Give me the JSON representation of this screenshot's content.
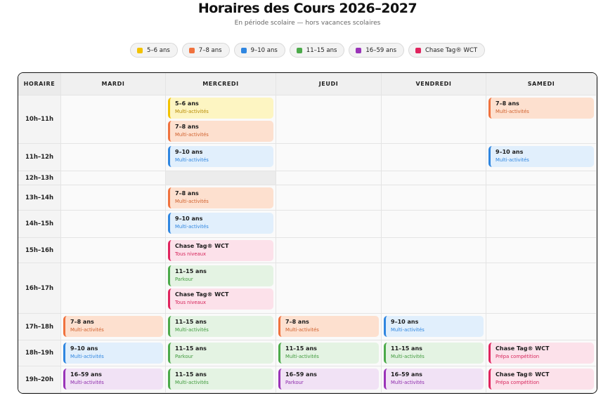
{
  "title": "Horaires des Cours 2026–2027",
  "subtitle": "En période scolaire — hors vacances scolaires",
  "groups": {
    "g56": {
      "label": "5–6 ans",
      "color": "#f2c200",
      "cls": "g-y"
    },
    "g78": {
      "label": "7–8 ans",
      "color": "#f0723e",
      "cls": "g-o"
    },
    "g910": {
      "label": "9–10 ans",
      "color": "#2f86e0",
      "cls": "g-b"
    },
    "g1115": {
      "label": "11–15 ans",
      "color": "#4caa4a",
      "cls": "g-g"
    },
    "g1659": {
      "label": "16–59 ans",
      "color": "#9a33b8",
      "cls": "g-p"
    },
    "gct": {
      "label": "Chase Tag® WCT",
      "color": "#e0245e",
      "cls": "g-r"
    }
  },
  "legend": [
    "g56",
    "g78",
    "g910",
    "g1115",
    "g1659",
    "gct"
  ],
  "header": {
    "horaire": "HORAIRE",
    "days": [
      "MARDI",
      "MERCREDI",
      "JEUDI",
      "VENDREDI",
      "SAMEDI"
    ]
  },
  "slots": [
    "10h–11h",
    "11h–12h",
    "12h–13h",
    "13h–14h",
    "14h–15h",
    "15h–16h",
    "16h–17h",
    "17h–18h",
    "18h–19h",
    "19h–20h"
  ],
  "lunch_slot": "12h–13h",
  "classes": [
    {
      "day": "MERCREDI",
      "slot": "10h–11h",
      "items": [
        {
          "group": "g56",
          "label": "5–6 ans",
          "activity": "Multi-activités"
        },
        {
          "group": "g78",
          "label": "7–8 ans",
          "activity": "Multi-activités"
        }
      ]
    },
    {
      "day": "SAMEDI",
      "slot": "10h–11h",
      "items": [
        {
          "group": "g78",
          "label": "7–8 ans",
          "activity": "Multi-activités"
        }
      ]
    },
    {
      "day": "MERCREDI",
      "slot": "11h–12h",
      "items": [
        {
          "group": "g910",
          "label": "9–10 ans",
          "activity": "Multi-activités"
        }
      ]
    },
    {
      "day": "SAMEDI",
      "slot": "11h–12h",
      "items": [
        {
          "group": "g910",
          "label": "9–10 ans",
          "activity": "Multi-activités"
        }
      ]
    },
    {
      "day": "MERCREDI",
      "slot": "13h–14h",
      "items": [
        {
          "group": "g78",
          "label": "7–8 ans",
          "activity": "Multi-activités"
        }
      ]
    },
    {
      "day": "MERCREDI",
      "slot": "14h–15h",
      "items": [
        {
          "group": "g910",
          "label": "9–10 ans",
          "activity": "Multi-activités"
        }
      ]
    },
    {
      "day": "MERCREDI",
      "slot": "15h–16h",
      "items": [
        {
          "group": "gct",
          "label": "Chase Tag® WCT",
          "activity": "Tous niveaux"
        }
      ]
    },
    {
      "day": "MERCREDI",
      "slot": "16h–17h",
      "items": [
        {
          "group": "g1115",
          "label": "11–15 ans",
          "activity": "Parkour"
        },
        {
          "group": "gct",
          "label": "Chase Tag® WCT",
          "activity": "Tous niveaux"
        }
      ]
    },
    {
      "day": "MARDI",
      "slot": "17h–18h",
      "items": [
        {
          "group": "g78",
          "label": "7–8 ans",
          "activity": "Multi-activités"
        }
      ]
    },
    {
      "day": "MERCREDI",
      "slot": "17h–18h",
      "items": [
        {
          "group": "g1115",
          "label": "11–15 ans",
          "activity": "Multi-activités"
        }
      ]
    },
    {
      "day": "JEUDI",
      "slot": "17h–18h",
      "items": [
        {
          "group": "g78",
          "label": "7–8 ans",
          "activity": "Multi-activités"
        }
      ]
    },
    {
      "day": "VENDREDI",
      "slot": "17h–18h",
      "items": [
        {
          "group": "g910",
          "label": "9–10 ans",
          "activity": "Multi-activités"
        }
      ]
    },
    {
      "day": "MARDI",
      "slot": "18h–19h",
      "items": [
        {
          "group": "g910",
          "label": "9–10 ans",
          "activity": "Multi-activités"
        }
      ]
    },
    {
      "day": "MERCREDI",
      "slot": "18h–19h",
      "items": [
        {
          "group": "g1115",
          "label": "11–15 ans",
          "activity": "Parkour"
        }
      ]
    },
    {
      "day": "JEUDI",
      "slot": "18h–19h",
      "items": [
        {
          "group": "g1115",
          "label": "11–15 ans",
          "activity": "Multi-activités"
        }
      ]
    },
    {
      "day": "VENDREDI",
      "slot": "18h–19h",
      "items": [
        {
          "group": "g1115",
          "label": "11–15 ans",
          "activity": "Multi-activités"
        }
      ]
    },
    {
      "day": "SAMEDI",
      "slot": "18h–19h",
      "items": [
        {
          "group": "gct",
          "label": "Chase Tag® WCT",
          "activity": "Prépa compétition"
        }
      ]
    },
    {
      "day": "MARDI",
      "slot": "19h–20h",
      "items": [
        {
          "group": "g1659",
          "label": "16–59 ans",
          "activity": "Multi-activités"
        }
      ]
    },
    {
      "day": "MERCREDI",
      "slot": "19h–20h",
      "items": [
        {
          "group": "g1115",
          "label": "11–15 ans",
          "activity": "Multi-activités"
        }
      ]
    },
    {
      "day": "JEUDI",
      "slot": "19h–20h",
      "items": [
        {
          "group": "g1659",
          "label": "16–59 ans",
          "activity": "Parkour"
        }
      ]
    },
    {
      "day": "VENDREDI",
      "slot": "19h–20h",
      "items": [
        {
          "group": "g1659",
          "label": "16–59 ans",
          "activity": "Multi-activités"
        }
      ]
    },
    {
      "day": "SAMEDI",
      "slot": "19h–20h",
      "items": [
        {
          "group": "gct",
          "label": "Chase Tag® WCT",
          "activity": "Prépa compétition"
        }
      ]
    }
  ]
}
